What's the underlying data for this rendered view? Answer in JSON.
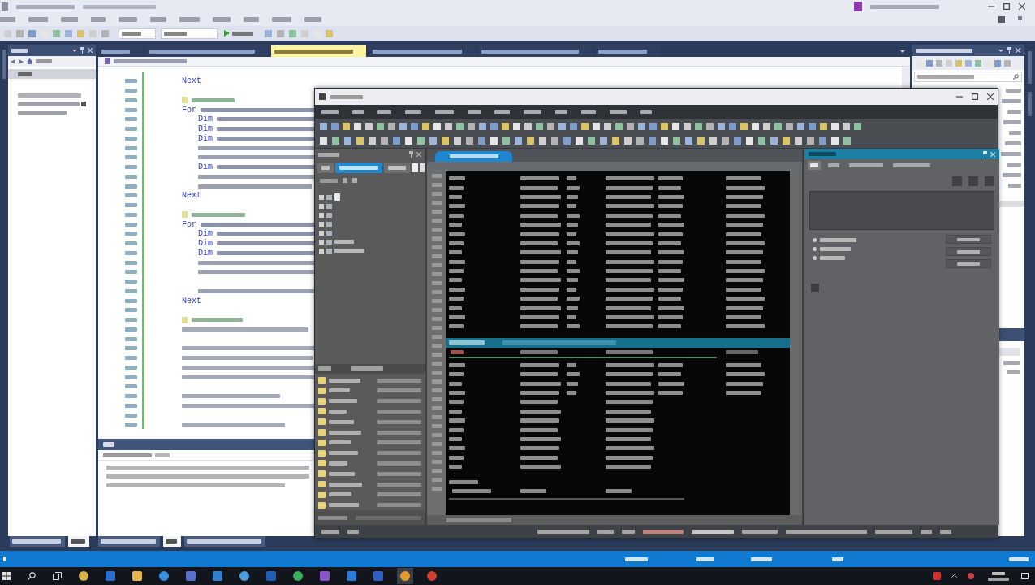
{
  "ide": {
    "editor_tabs": [
      {
        "selected": false
      },
      {
        "selected": false
      },
      {
        "selected": true
      },
      {
        "selected": false
      },
      {
        "selected": false
      },
      {
        "selected": false
      }
    ],
    "code_blocks": [
      {
        "lines": [
          {
            "kind": "keyword",
            "text": "Next"
          }
        ]
      },
      {
        "lines": [
          {
            "kind": "comment"
          },
          {
            "kind": "statement",
            "text": "For"
          },
          {
            "kind": "nested_statement",
            "text": "Dim"
          },
          {
            "kind": "nested_statement",
            "text": "Dim"
          },
          {
            "kind": "nested_statement",
            "text": "Dim"
          },
          {
            "kind": "nested"
          },
          {
            "kind": "nested"
          },
          {
            "kind": "nested_statement",
            "text": "Dim"
          },
          {
            "kind": "nested"
          },
          {
            "kind": "nested"
          },
          {
            "kind": "keyword",
            "text": "Next"
          }
        ]
      },
      {
        "lines": [
          {
            "kind": "comment"
          },
          {
            "kind": "statement",
            "text": "For"
          },
          {
            "kind": "nested_statement",
            "text": "Dim"
          },
          {
            "kind": "nested_statement",
            "text": "Dim"
          },
          {
            "kind": "nested_statement",
            "text": "Dim"
          },
          {
            "kind": "nested"
          },
          {
            "kind": "nested"
          }
        ]
      },
      {
        "lines": [
          {
            "kind": "nested"
          },
          {
            "kind": "keyword",
            "text": "Next"
          }
        ]
      },
      {
        "lines": [
          {
            "kind": "comment"
          },
          {
            "kind": "plain"
          }
        ]
      },
      {
        "lines": [
          {
            "kind": "plain"
          },
          {
            "kind": "plain"
          },
          {
            "kind": "plain"
          },
          {
            "kind": "plain"
          }
        ]
      },
      {
        "lines": [
          {
            "kind": "plain"
          },
          {
            "kind": "plain"
          }
        ]
      },
      {
        "lines": [
          {
            "kind": "plain"
          }
        ]
      }
    ],
    "explorer_tabs": [
      {
        "selected": false
      },
      {
        "selected": true
      }
    ],
    "output_tabs": [
      {
        "selected": false
      },
      {
        "selected": true
      },
      {
        "selected": false
      }
    ]
  },
  "overlay_app": {
    "side_tabs": [
      {
        "selected": false
      },
      {
        "selected": true
      },
      {
        "selected": false
      }
    ],
    "document_tabs": [
      {
        "selected": true
      }
    ],
    "property_tabs": [
      {
        "selected": true
      },
      {
        "selected": false
      },
      {
        "selected": false
      },
      {
        "selected": false
      }
    ]
  }
}
